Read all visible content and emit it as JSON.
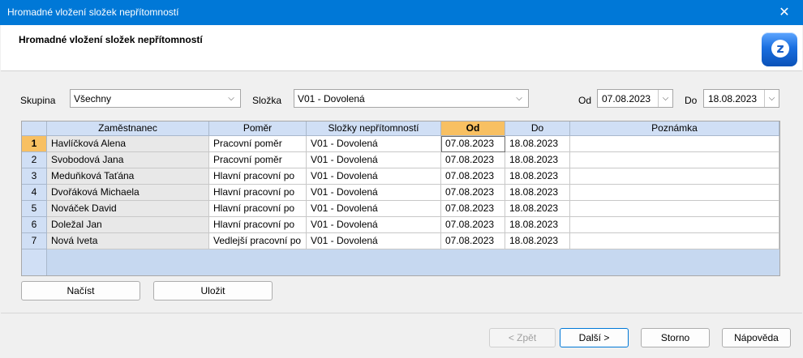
{
  "window": {
    "title": "Hromadné vložení složek nepřítomností",
    "close_glyph": "✕"
  },
  "header": {
    "title": "Hromadné vložení složek nepřítomností",
    "logo_icon": "app-logo-icon",
    "logo_glyph": "z"
  },
  "filters": {
    "skupina_label": "Skupina",
    "skupina_value": "Všechny",
    "slozka_label": "Složka",
    "slozka_value": "V01 - Dovolená",
    "od_label": "Od",
    "od_value": "07.08.2023",
    "do_label": "Do",
    "do_value": "18.08.2023"
  },
  "grid": {
    "columns": [
      "Zaměstnanec",
      "Poměr",
      "Složky nepřítomností",
      "Od",
      "Do",
      "Poznámka"
    ],
    "active_column": "Od",
    "rows": [
      {
        "num": "1",
        "employee": "Havlíčková Alena",
        "pomer": "Pracovní poměr",
        "slozka": "V01 - Dovolená",
        "od": "07.08.2023",
        "do": "18.08.2023",
        "poznamka": ""
      },
      {
        "num": "2",
        "employee": "Svobodová Jana",
        "pomer": "Pracovní poměr",
        "slozka": "V01 - Dovolená",
        "od": "07.08.2023",
        "do": "18.08.2023",
        "poznamka": ""
      },
      {
        "num": "3",
        "employee": "Meduňková Taťána",
        "pomer": "Hlavní pracovní po",
        "slozka": "V01 - Dovolená",
        "od": "07.08.2023",
        "do": "18.08.2023",
        "poznamka": ""
      },
      {
        "num": "4",
        "employee": "Dvořáková Michaela",
        "pomer": "Hlavní pracovní po",
        "slozka": "V01 - Dovolená",
        "od": "07.08.2023",
        "do": "18.08.2023",
        "poznamka": ""
      },
      {
        "num": "5",
        "employee": "Nováček David",
        "pomer": "Hlavní pracovní po",
        "slozka": "V01 - Dovolená",
        "od": "07.08.2023",
        "do": "18.08.2023",
        "poznamka": ""
      },
      {
        "num": "6",
        "employee": "Doležal Jan",
        "pomer": "Hlavní pracovní po",
        "slozka": "V01 - Dovolená",
        "od": "07.08.2023",
        "do": "18.08.2023",
        "poznamka": ""
      },
      {
        "num": "7",
        "employee": "Nová Iveta",
        "pomer": "Vedlejší pracovní po",
        "slozka": "V01 - Dovolená",
        "od": "07.08.2023",
        "do": "18.08.2023",
        "poznamka": ""
      }
    ]
  },
  "actions": {
    "nacist": "Načíst",
    "ulozit": "Uložit"
  },
  "footer": {
    "zpet": "< Zpět",
    "dalsi": "Další >",
    "storno": "Storno",
    "napoveda": "Nápověda"
  },
  "colors": {
    "titlebar": "#0078d7",
    "active_header": "#f8c062",
    "grid_header": "#d0dff5"
  }
}
